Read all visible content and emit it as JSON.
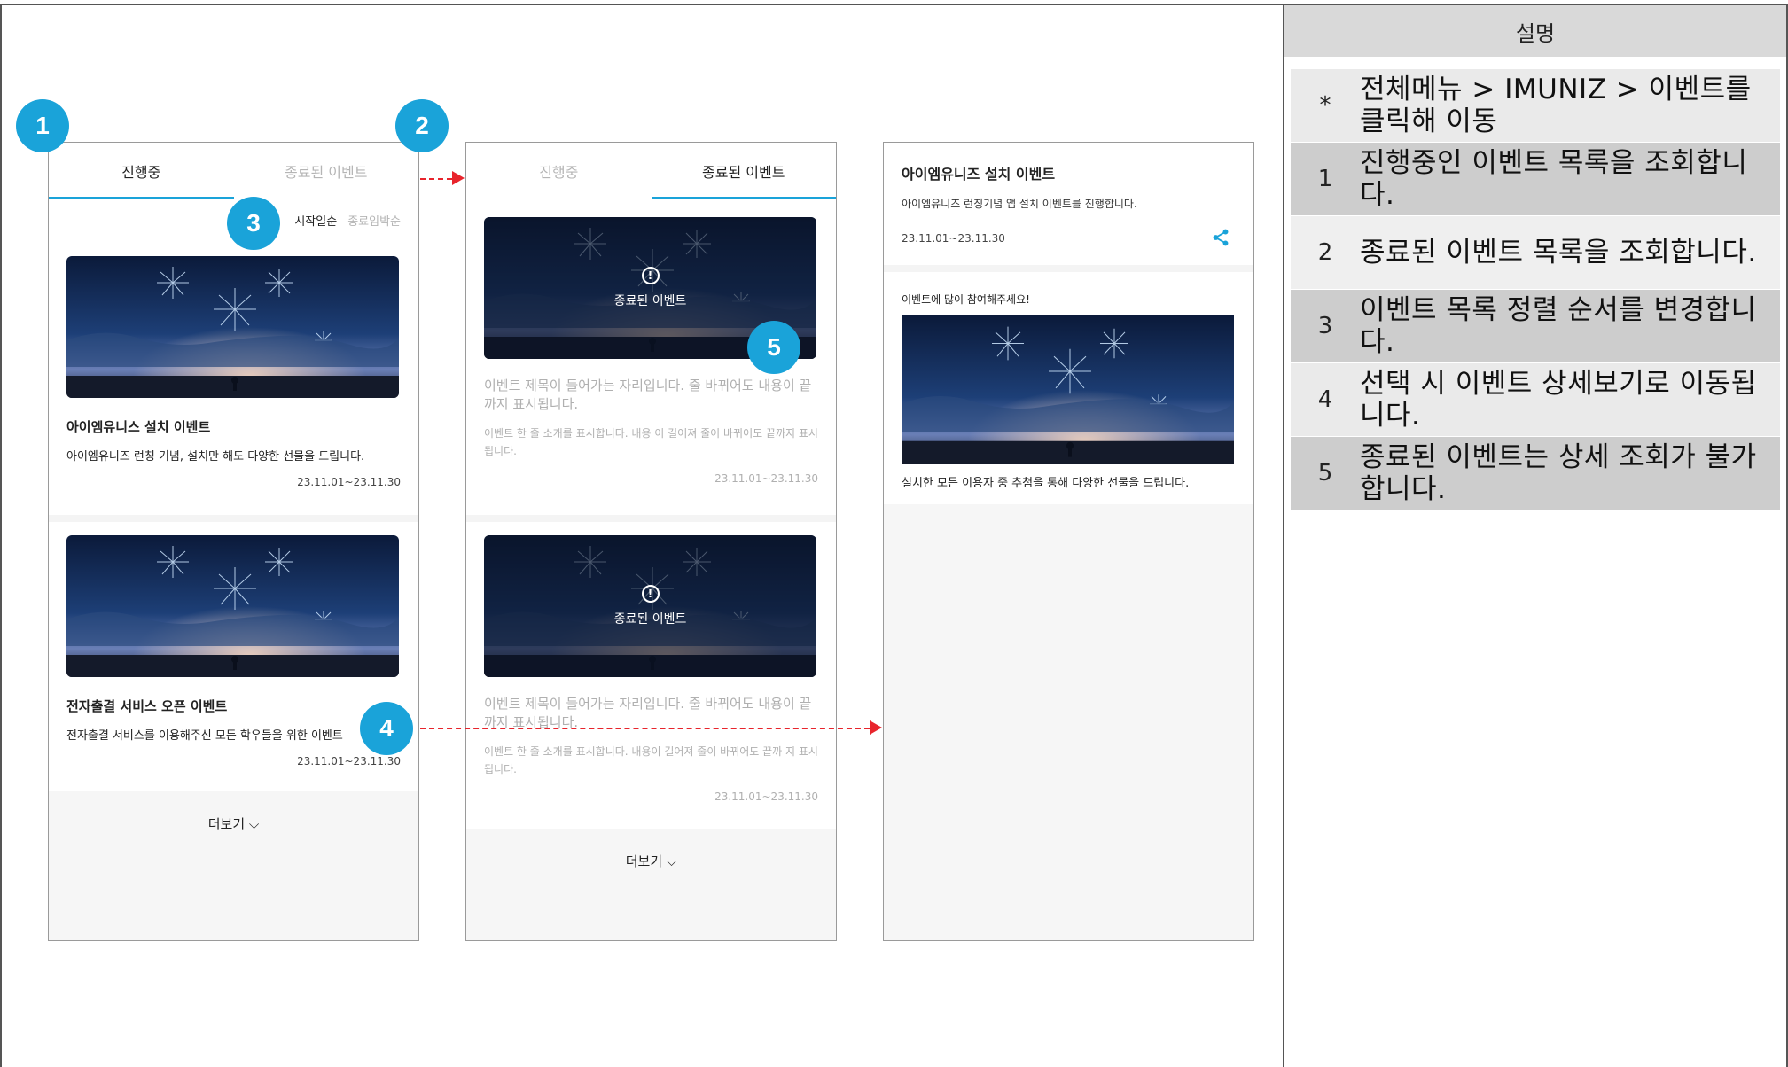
{
  "colors": {
    "accent": "#1aa3d9",
    "arrow": "#e8242c",
    "rowDark": "#cdcdcd",
    "rowLight": "#eaeaea"
  },
  "badges": [
    "1",
    "2",
    "3",
    "4",
    "5"
  ],
  "phone1": {
    "tabs": [
      "진행중",
      "종료된 이벤트"
    ],
    "sort": {
      "active": "시작일순",
      "inactive": "종료임박순"
    },
    "cards": [
      {
        "title": "아이엠유니스 설치 이벤트",
        "desc": "아이엠유니즈 런칭 기념, 설치만 해도 다양한 선물을 드립니다.",
        "date": "23.11.01~23.11.30"
      },
      {
        "title": "전자출결 서비스 오픈 이벤트",
        "desc": "전자출결 서비스를 이용해주신 모든 학우들을 위한 이벤트",
        "date": "23.11.01~23.11.30"
      }
    ],
    "more": "더보기"
  },
  "phone2": {
    "tabs": [
      "진행중",
      "종료된 이벤트"
    ],
    "overlay": "종료된 이벤트",
    "cards": [
      {
        "title": "이벤트 제목이 들어가는 자리입니다. 줄 바뀌어도 내용이 끝까지 표시됩니다.",
        "desc": "이벤트 한 줄 소개를 표시합니다. 내용 이 길어져 줄이 바뀌어도 끝까지 표시됩니다.",
        "date": "23.11.01~23.11.30"
      },
      {
        "title": "이벤트 제목이 들어가는 자리입니다. 줄 바뀌어도 내용이 끝까지 표시됩니다.",
        "desc": "이벤트 한 줄 소개를 표시합니다. 내용이 길어져 줄이 바뀌어도 끝까 지 표시됩니다.",
        "date": "23.11.01~23.11.30"
      }
    ],
    "more": "더보기"
  },
  "phone3": {
    "title": "아이엠유니즈 설치 이벤트",
    "subtitle": "아이엠유니즈 런칭기념 앱 설치 이벤트를 진행합니다.",
    "date": "23.11.01~23.11.30",
    "lead": "이벤트에 많이 참여해주세요!",
    "footer": "설치한 모든 이용자 중 추첨을 통해 다양한 선물을 드립니다."
  },
  "description": {
    "header": "설명",
    "rows": [
      {
        "num": "*",
        "text": "전체메뉴 > IMUNIZ > 이벤트를 클릭해 이동"
      },
      {
        "num": "1",
        "text": "진행중인 이벤트 목록을 조회합니다."
      },
      {
        "num": "2",
        "text": "종료된 이벤트 목록을 조회합니다."
      },
      {
        "num": "3",
        "text": "이벤트 목록 정렬 순서를 변경합니다."
      },
      {
        "num": "4",
        "text": "선택 시 이벤트 상세보기로 이동됩니다."
      },
      {
        "num": "5",
        "text": "종료된 이벤트는 상세 조회가 불가합니다."
      }
    ]
  }
}
